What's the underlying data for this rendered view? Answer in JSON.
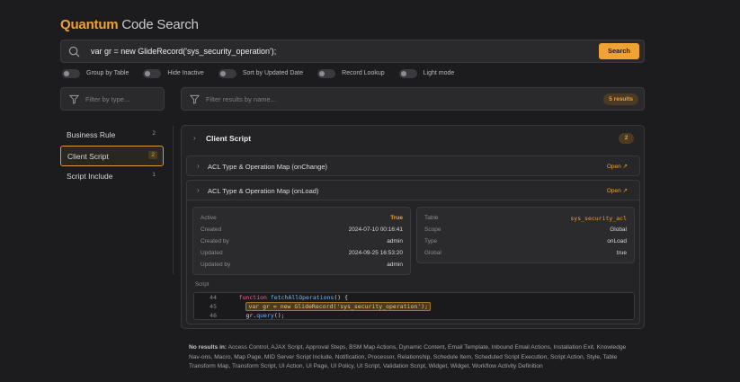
{
  "brand": {
    "part1": "Quantum",
    "part2": "Code Search"
  },
  "search": {
    "query": "var gr = new GlideRecord('sys_security_operation');",
    "button": "Search"
  },
  "toggles": [
    {
      "label": "Group by Table"
    },
    {
      "label": "Hide Inactive"
    },
    {
      "label": "Sort by Updated Date"
    },
    {
      "label": "Record Lookup"
    },
    {
      "label": "Light mode"
    }
  ],
  "type_filter": {
    "placeholder": "Filter by type..."
  },
  "result_filter": {
    "placeholder": "Filter results by name...",
    "count": "5 results"
  },
  "sidebar": {
    "items": [
      {
        "label": "Business Rule",
        "count": "2"
      },
      {
        "label": "Client Script",
        "count": "2"
      },
      {
        "label": "Script Include",
        "count": "1"
      }
    ]
  },
  "group": {
    "title": "Client Script",
    "count": "2"
  },
  "results": [
    {
      "title": "ACL Type & Operation Map (onChange)",
      "open": "Open ↗"
    },
    {
      "title": "ACL Type & Operation Map (onLoad)",
      "open": "Open ↗"
    }
  ],
  "details": {
    "left": [
      {
        "k": "Active",
        "v": "True"
      },
      {
        "k": "Created",
        "v": "2024-07-10 00:16:41"
      },
      {
        "k": "Created by",
        "v": "admin"
      },
      {
        "k": "Updated",
        "v": "2024-09-25 16:53:20"
      },
      {
        "k": "Updated by",
        "v": "admin"
      }
    ],
    "right": [
      {
        "k": "Table",
        "v": "sys_security_acl"
      },
      {
        "k": "Scope",
        "v": "Global"
      },
      {
        "k": "Type",
        "v": "onLoad"
      },
      {
        "k": "Global",
        "v": "true"
      }
    ],
    "script_label": "Script",
    "code": [
      {
        "ln": "44",
        "indent": "    ",
        "kw": "function",
        "fn": "fetchAllOperations",
        "rest": "() {"
      },
      {
        "ln": "45",
        "indent": "      ",
        "hl": "var gr = new GlideRecord('sys_security_operation');"
      },
      {
        "ln": "46",
        "indent": "      ",
        "pre": "gr.",
        "fn": "query",
        "rest": "();"
      }
    ]
  },
  "no_results": {
    "label": "No results in:",
    "text": "Access Control, AJAX Script, Approval Steps, BSM Map Actions, Dynamic Content, Email Template, Inbound Email Actions, Installation Exit, Knowledge Nav-ons, Macro, Map Page, MID Server Script Include, Notification, Processor, Relationship, Schedule Item, Scheduled Script Execution, Script Action, Style, Table Transform Map, Transform Script, UI Action, UI Page, UI Policy, UI Script, Validation Script, Widget, Widget, Workflow Activity Definition"
  }
}
